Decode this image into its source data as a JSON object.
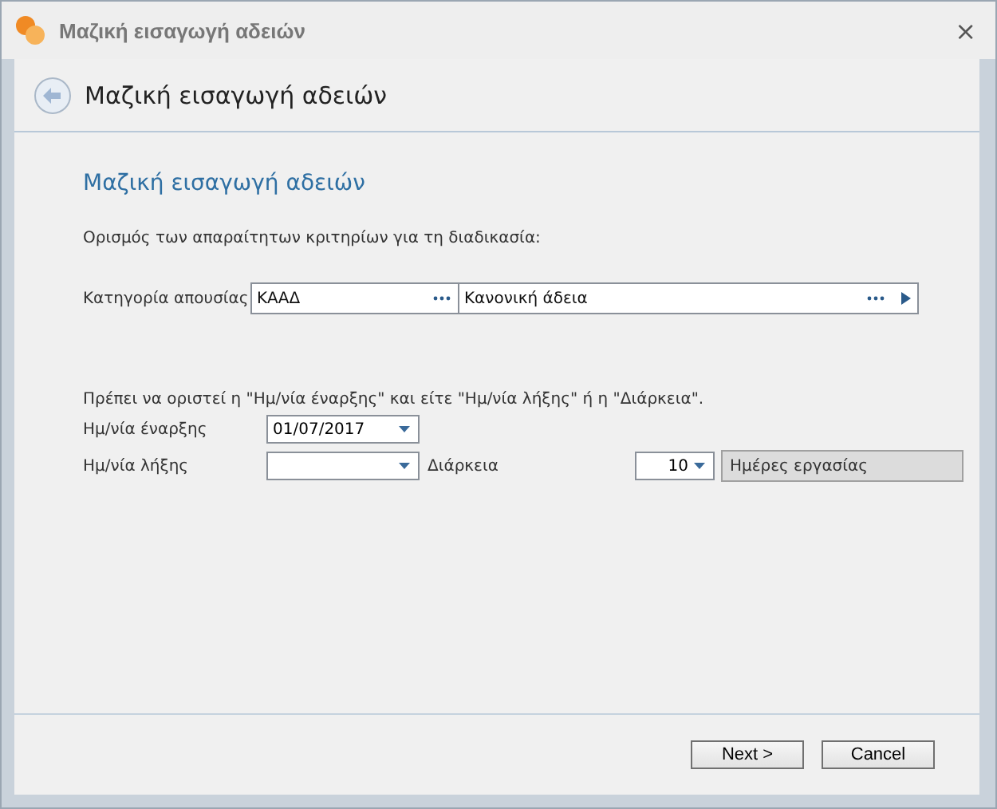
{
  "window": {
    "title": "Μαζική εισαγωγή αδειών",
    "close": "×"
  },
  "header": {
    "title": "Μαζική εισαγωγή αδειών"
  },
  "section_title": "Μαζική εισαγωγή αδειών",
  "intro": "Ορισμός των απαραίτητων κριτηρίων για τη διαδικασία:",
  "category": {
    "label": "Κατηγορία απουσίας",
    "code": "ΚΑΑΔ",
    "description": "Κανονική άδεια"
  },
  "note": "Πρέπει να οριστεί η \"Ημ/νία έναρξης\" και είτε \"Ημ/νία λήξης\" ή η \"Διάρκεια\".",
  "start_date": {
    "label": "Ημ/νία έναρξης",
    "value": "01/07/2017"
  },
  "end_date": {
    "label": "Ημ/νία λήξης"
  },
  "duration": {
    "label": "Διάρκεια",
    "value": "10",
    "unit": "Ημέρες εργασίας"
  },
  "buttons": [
    {
      "label": "Next >"
    },
    {
      "label": "Cancel"
    }
  ]
}
